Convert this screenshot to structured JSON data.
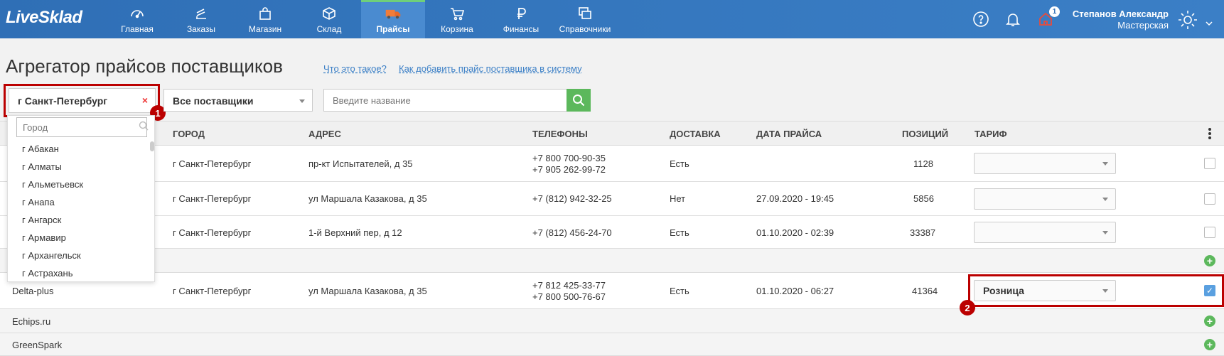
{
  "header": {
    "logo": "LiveSklad",
    "nav": [
      {
        "label": "Главная",
        "icon": "dashboard-icon"
      },
      {
        "label": "Заказы",
        "icon": "orders-icon"
      },
      {
        "label": "Магазин",
        "icon": "shop-bag-icon"
      },
      {
        "label": "Склад",
        "icon": "warehouse-box-icon"
      },
      {
        "label": "Прайсы",
        "icon": "truck-icon",
        "active": true
      },
      {
        "label": "Корзина",
        "icon": "cart-icon"
      },
      {
        "label": "Финансы",
        "icon": "ruble-icon"
      },
      {
        "label": "Справочники",
        "icon": "directories-icon"
      }
    ],
    "notifications_badge": "1",
    "user_name": "Степанов Александр",
    "user_role": "Мастерская"
  },
  "page": {
    "title": "Агрегатор прайсов поставщиков",
    "link_what": "Что это такое?",
    "link_how": "Как добавить прайс поставщика в систему"
  },
  "filters": {
    "city_value": "г Санкт-Петербург",
    "city_clear": "×",
    "supplier_value": "Все поставщики",
    "search_placeholder": "Введите название"
  },
  "markers": {
    "one": "1",
    "two": "2"
  },
  "city_dropdown": {
    "search_placeholder": "Город",
    "items": [
      "г Абакан",
      "г Алматы",
      "г Альметьевск",
      "г Анапа",
      "г Ангарск",
      "г Армавир",
      "г Архангельск",
      "г Астрахань"
    ]
  },
  "table": {
    "columns": {
      "city": "ГОРОД",
      "address": "АДРЕС",
      "phones": "ТЕЛЕФОНЫ",
      "delivery": "ДОСТАВКА",
      "price_date": "ДАТА ПРАЙСА",
      "positions": "ПОЗИЦИЙ",
      "tariff": "ТАРИФ"
    },
    "rows": [
      {
        "city": "г Санкт-Петербург",
        "address": "пр-кт Испытателей, д 35",
        "phone1": "+7 800 700-90-35",
        "phone2": "+7 905 262-99-72",
        "delivery": "Есть",
        "date": "",
        "positions": "1128",
        "tariff": ""
      },
      {
        "city": "г Санкт-Петербург",
        "address": "ул Маршала Казакова, д 35",
        "phone1": "+7 (812) 942-32-25",
        "phone2": "",
        "delivery": "Нет",
        "date": "27.09.2020 - 19:45",
        "positions": "5856",
        "tariff": ""
      },
      {
        "city": "г Санкт-Петербург",
        "address": "1-й Верхний пер, д 12",
        "phone1": "+7 (812) 456-24-70",
        "phone2": "",
        "delivery": "Есть",
        "date": "01.10.2020 - 02:39",
        "positions": "33387",
        "tariff": ""
      }
    ],
    "delta": {
      "name": "Delta-plus",
      "city": "г Санкт-Петербург",
      "address": "ул Маршала Казакова, д 35",
      "phone1": "+7 812 425-33-77",
      "phone2": "+7 800 500-76-67",
      "delivery": "Есть",
      "date": "01.10.2020 - 06:27",
      "positions": "41364",
      "tariff": "Розница"
    },
    "groups": [
      "Echips.ru",
      "GreenSpark"
    ]
  },
  "colors": {
    "brand": "#2f6fb6",
    "accent_green": "#5cb85c",
    "highlight_red": "#b00000"
  }
}
